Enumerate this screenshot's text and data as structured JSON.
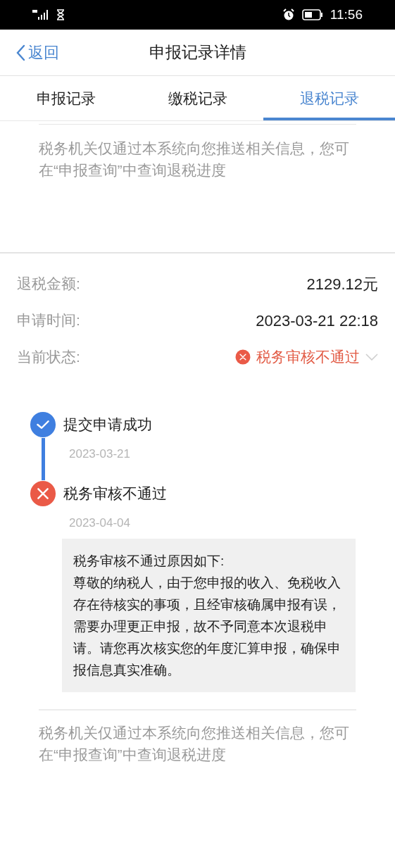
{
  "status_bar": {
    "time": "11:56"
  },
  "nav": {
    "back": "返回",
    "title": "申报记录详情"
  },
  "tabs": [
    {
      "label": "申报记录",
      "selected": false
    },
    {
      "label": "缴税记录",
      "selected": false
    },
    {
      "label": "退税记录",
      "selected": true
    }
  ],
  "top_notice": "税务机关仅通过本系统向您推送相关信息，您可在“申报查询”中查询退税进度",
  "details": [
    {
      "kind": "text",
      "label": "退税金额:",
      "value": "2129.12元"
    },
    {
      "kind": "text",
      "label": "申请时间:",
      "value": "2023-03-21 22:18"
    },
    {
      "kind": "status",
      "label": "当前状态:",
      "value": "税务审核不通过"
    }
  ],
  "timeline": [
    {
      "kind": "success",
      "title": "提交申请成功",
      "date": "2023-03-21"
    },
    {
      "kind": "failure",
      "title": "税务审核不通过",
      "date": "2023-04-04",
      "reason_title": "税务审核不通过原因如下:",
      "reason": "尊敬的纳税人，由于您申报的收入、免税收入存在待核实的事项，且经审核确属申报有误，需要办理更正申报，故不予同意本次退税申请。请您再次核实您的年度汇算申报，确保申报信息真实准确。"
    }
  ],
  "bottom_notice": "税务机关仅通过本系统向您推送相关信息，您可在“申报查询”中查询退税进度"
}
